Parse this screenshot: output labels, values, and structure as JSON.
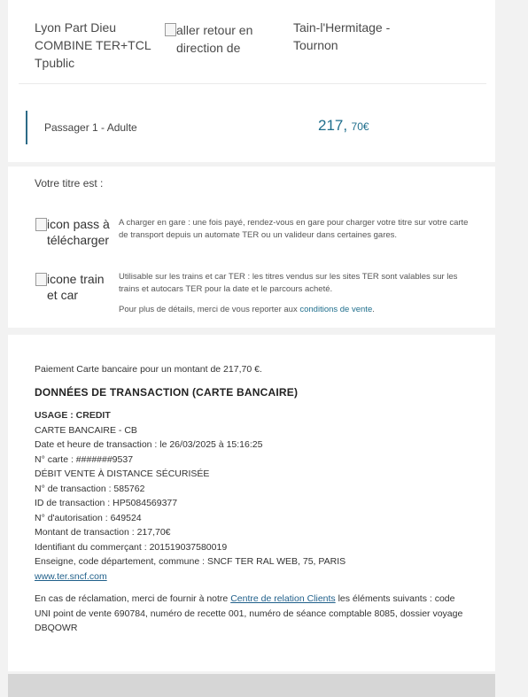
{
  "journey": {
    "departure": "Lyon Part Dieu COMBINE TER+TCL Tpublic",
    "direction_alt": "aller retour en direction de",
    "arrival": "Tain-l'Hermitage - Tournon"
  },
  "passenger": {
    "label": "Passager 1 - Adulte",
    "price_int": "217,",
    "price_dec": "70€"
  },
  "ticket_info": {
    "title": "Votre titre est :",
    "download_alt": "icon pass à télécharger",
    "download_text": "A charger en gare : une fois payé, rendez-vous en gare pour charger votre titre sur votre carte de transport depuis un automate TER ou un valideur dans certaines gares.",
    "train_car_alt": "icone train et car",
    "train_car_text": "Utilisable sur les trains et car TER : les titres vendus sur les sites TER sont valables sur les trains et autocars TER pour la date et le parcours acheté.",
    "details_prefix": "Pour plus de détails, merci de vous reporter aux ",
    "details_link": "conditions de vente",
    "details_suffix": "."
  },
  "payment": {
    "summary": "Paiement Carte bancaire pour un montant de 217,70 €.",
    "heading": "DONNÉES DE TRANSACTION (CARTE BANCAIRE)",
    "usage": "USAGE : CREDIT",
    "card_type": "CARTE BANCAIRE - CB",
    "datetime": "Date et heure de transaction : le 26/03/2025 à 15:16:25",
    "card_number": "N° carte : #######9537",
    "debit": "DÉBIT VENTE À DISTANCE SÉCURISÉE",
    "transaction_no": "N° de transaction : 585762",
    "transaction_id": "ID de transaction : HP5084569377",
    "authorization": "N° d'autorisation : 649524",
    "amount": "Montant de transaction : 217,70€",
    "merchant_id": "Identifiant du commerçant : 201519037580019",
    "merchant": "Enseigne, code département, commune : SNCF TER RAL WEB, 75, PARIS",
    "website": "www.ter.sncf.com"
  },
  "claim": {
    "prefix": "En cas de réclamation, merci de fournir à notre ",
    "link": "Centre de relation Clients",
    "suffix": " les éléments suivants : code UNI point de vente 690784, numéro de recette 001, numéro de séance comptable 8085, dossier voyage DBQOWR"
  }
}
